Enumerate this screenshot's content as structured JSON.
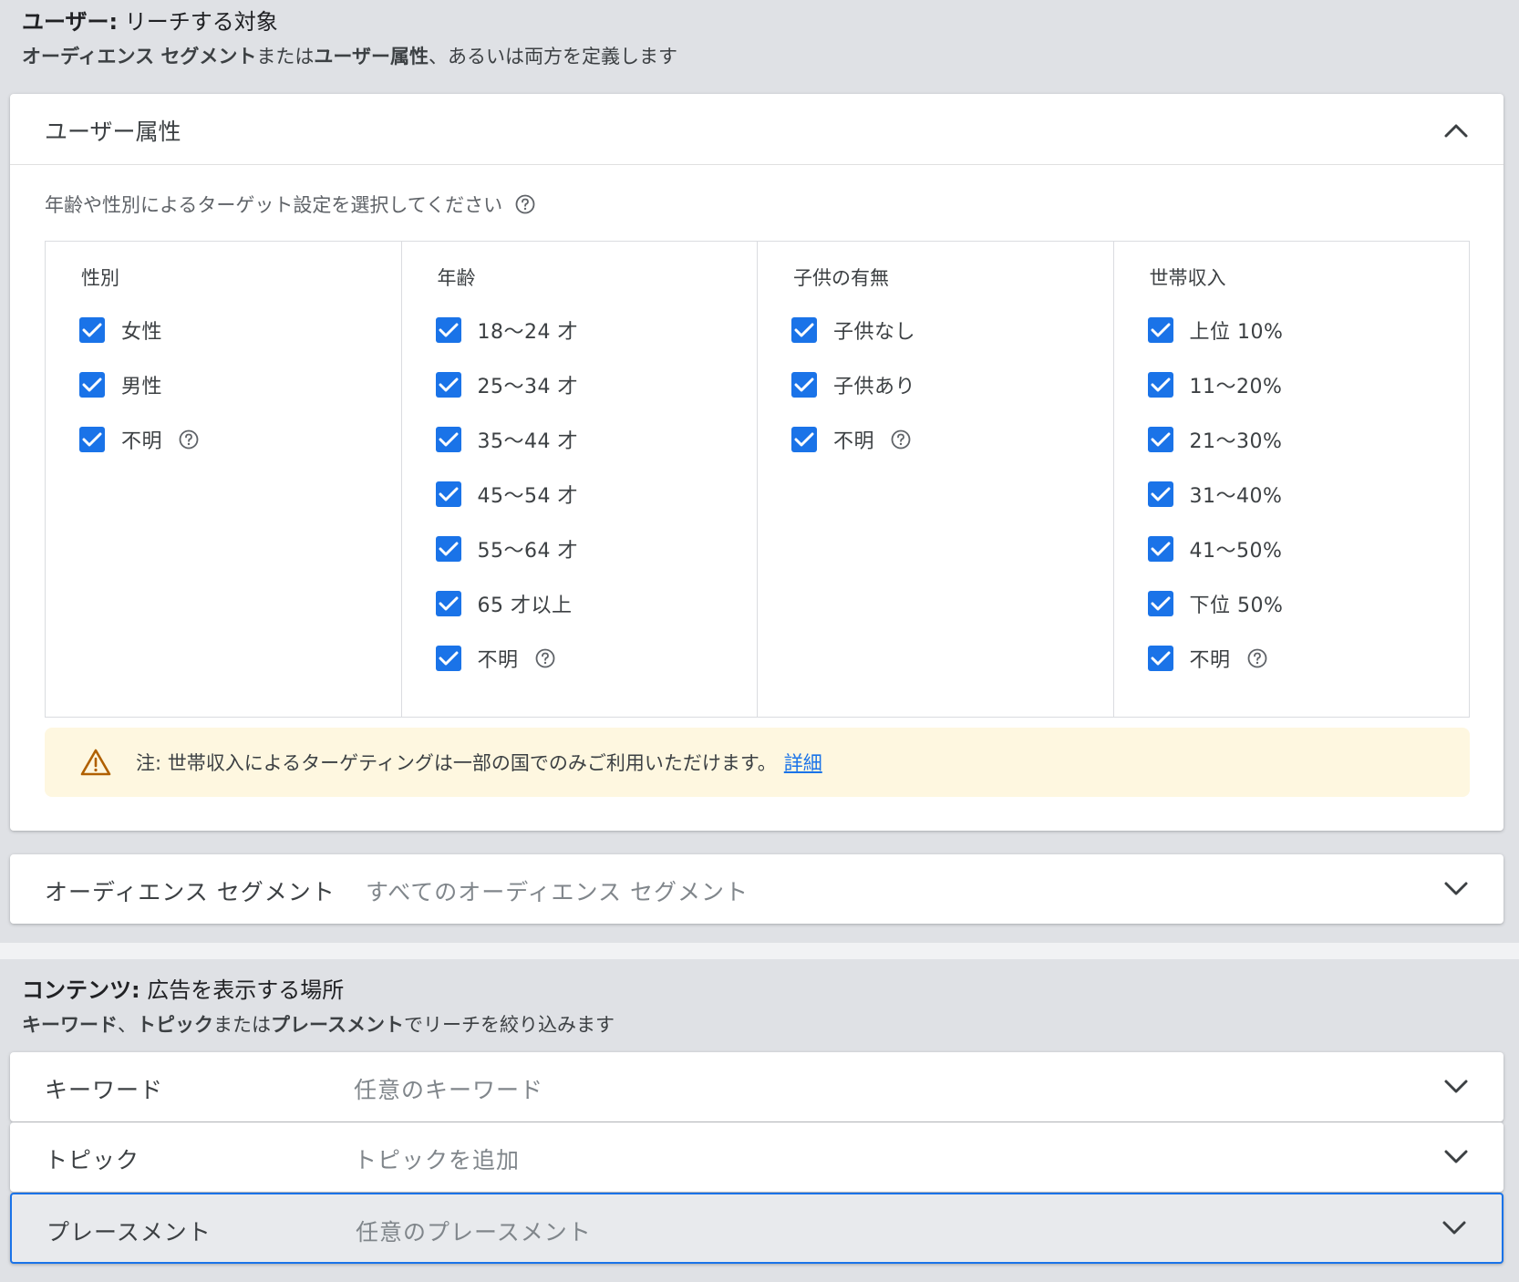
{
  "users_section": {
    "title_bold": "ユーザー:",
    "title_rest": " リーチする対象",
    "sub_b1": "オーディエンス セグメント",
    "sub_t1": "または",
    "sub_b2": "ユーザー属性",
    "sub_t2": "、あるいは両方を定義します"
  },
  "demographics": {
    "title": "ユーザー属性",
    "hint": "年齢や性別によるターゲット設定を選択してください",
    "columns": [
      {
        "title": "性別",
        "options": [
          "女性",
          "男性",
          "不明"
        ]
      },
      {
        "title": "年齢",
        "options": [
          "18〜24 才",
          "25〜34 才",
          "35〜44 才",
          "45〜54 才",
          "55〜64 才",
          "65 才以上",
          "不明"
        ]
      },
      {
        "title": "子供の有無",
        "options": [
          "子供なし",
          "子供あり",
          "不明"
        ]
      },
      {
        "title": "世帯収入",
        "options": [
          "上位 10%",
          "11〜20%",
          "21〜30%",
          "31〜40%",
          "41〜50%",
          "下位 50%",
          "不明"
        ]
      }
    ],
    "notice_text": "注: 世帯収入によるターゲティングは一部の国でのみご利用いただけます。",
    "notice_link": "詳細"
  },
  "audience_row": {
    "title": "オーディエンス セグメント",
    "value": "すべてのオーディエンス セグメント"
  },
  "content_section": {
    "title_bold": "コンテンツ:",
    "title_rest": " 広告を表示する場所",
    "sub_b1": "キーワード",
    "sub_t1": "、",
    "sub_b2": "トピック",
    "sub_t2": "または",
    "sub_b3": "プレースメント",
    "sub_t3": "でリーチを絞り込みます"
  },
  "content_rows": [
    {
      "title": "キーワード",
      "value": "任意のキーワード"
    },
    {
      "title": "トピック",
      "value": "トピックを追加"
    },
    {
      "title": "プレースメント",
      "value": "任意のプレースメント"
    }
  ],
  "colors": {
    "accent": "#1a73e8",
    "notice_bg": "#fef7e0",
    "warn": "#b06000",
    "section_bg": "#dfe1e5"
  }
}
